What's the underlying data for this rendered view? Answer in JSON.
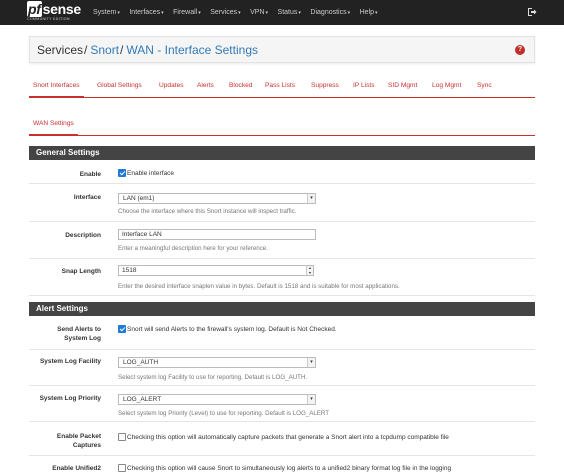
{
  "navbar": {
    "logo_main": "sense",
    "logo_pf": "pf",
    "logo_sub": "COMMUNITY EDITION",
    "menu": [
      {
        "label": "System"
      },
      {
        "label": "Interfaces"
      },
      {
        "label": "Firewall"
      },
      {
        "label": "Services"
      },
      {
        "label": "VPN"
      },
      {
        "label": "Status"
      },
      {
        "label": "Diagnostics"
      },
      {
        "label": "Help"
      }
    ]
  },
  "breadcrumb": {
    "root": "Services",
    "parent": "Snort",
    "current": "WAN - Interface Settings",
    "separator": "/"
  },
  "tabs": [
    {
      "label": "Snort Interfaces",
      "active": true
    },
    {
      "label": "Global Settings"
    },
    {
      "label": "Updates"
    },
    {
      "label": "Alerts"
    },
    {
      "label": "Blocked"
    },
    {
      "label": "Pass Lists"
    },
    {
      "label": "Suppress"
    },
    {
      "label": "IP Lists"
    },
    {
      "label": "SID Mgmt"
    },
    {
      "label": "Log Mgmt"
    },
    {
      "label": "Sync"
    }
  ],
  "subtabs": [
    {
      "label": "WAN Settings",
      "active": true
    }
  ],
  "general": {
    "heading": "General Settings",
    "enable": {
      "label": "Enable",
      "checkbox_label": "Enable interface",
      "checked": true
    },
    "interface": {
      "label": "Interface",
      "value": "LAN (em1)",
      "help": "Choose the interface where this Snort instance will inspect traffic."
    },
    "description": {
      "label": "Description",
      "value": "Interface LAN",
      "help": "Enter a meaningful description here for your reference."
    },
    "snaplen": {
      "label": "Snap Length",
      "value": "1518",
      "help": "Enter the desired interface snaplen value in bytes. Default is 1518 and is suitable for most applications."
    }
  },
  "alerts": {
    "heading": "Alert Settings",
    "send_alerts": {
      "label1": "Send Alerts to",
      "label2": "System Log",
      "checkbox_label": "Snort will send Alerts to the firewall's system log. Default is Not Checked.",
      "checked": true
    },
    "facility": {
      "label": "System Log Facility",
      "value": "LOG_AUTH",
      "help": "Select system log Facility to use for reporting. Default is LOG_AUTH."
    },
    "priority": {
      "label": "System Log Priority",
      "value": "LOG_ALERT",
      "help": "Select system log Priority (Level) to use for reporting. Default is LOG_ALERT"
    },
    "packet_captures": {
      "label1": "Enable Packet",
      "label2": "Captures",
      "checkbox_label": "Checking this option will automatically capture packets that generate a Snort alert into a tcpdump compatible file",
      "checked": false
    },
    "unified2": {
      "label1": "Enable Unified2",
      "checkbox_label": "Checking this option will cause Snort to simultaneously log alerts to a unified2 binary format log file in the logging",
      "checked": false
    }
  },
  "colors": {
    "accent": "#c9302c",
    "link": "#337ab7",
    "navbar": "#222222",
    "panel_heading": "#444444",
    "checkbox": "#1e7ad8"
  }
}
